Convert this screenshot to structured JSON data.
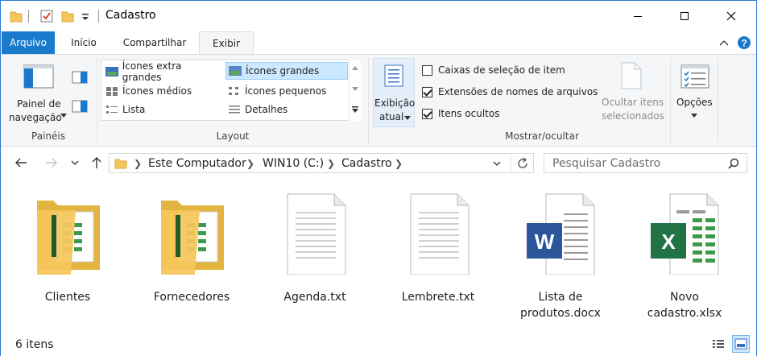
{
  "window": {
    "title": "Cadastro"
  },
  "ribbon_tabs": [
    {
      "label": "Arquivo"
    },
    {
      "label": "Início"
    },
    {
      "label": "Compartilhar"
    },
    {
      "label": "Exibir"
    }
  ],
  "ribbon": {
    "paineis": {
      "nav_pane_line1": "Painel de",
      "nav_pane_line2": "navegação",
      "group_label": "Painéis"
    },
    "layout": {
      "items": [
        {
          "label": "Ícones extra grandes"
        },
        {
          "label": "Ícones grandes"
        },
        {
          "label": "Ícones médios"
        },
        {
          "label": "Ícones pequenos"
        },
        {
          "label": "Lista"
        },
        {
          "label": "Detalhes"
        }
      ],
      "selected": "Ícones grandes",
      "current_view_line1": "Exibição",
      "current_view_line2": "atual",
      "group_label": "Layout"
    },
    "mostrar_ocultar": {
      "checkboxes": [
        {
          "label": "Caixas de seleção de item",
          "checked": false
        },
        {
          "label": "Extensões de nomes de arquivos",
          "checked": true
        },
        {
          "label": "Itens ocultos",
          "checked": true
        }
      ],
      "hide_items_line1": "Ocultar itens",
      "hide_items_line2": "selecionados",
      "options_label": "Opções",
      "group_label": "Mostrar/ocultar"
    }
  },
  "address_bar": {
    "crumbs": [
      {
        "label": "Este Computador"
      },
      {
        "label": "WIN10 (C:)"
      },
      {
        "label": "Cadastro"
      }
    ]
  },
  "search": {
    "placeholder": "Pesquisar Cadastro"
  },
  "files": [
    {
      "name": "Clientes",
      "type": "folder"
    },
    {
      "name": "Fornecedores",
      "type": "folder"
    },
    {
      "name": "Agenda.txt",
      "type": "txt"
    },
    {
      "name": "Lembrete.txt",
      "type": "txt"
    },
    {
      "name_line1": "Lista de",
      "name_line2": "produtos.docx",
      "type": "docx"
    },
    {
      "name_line1": "Novo",
      "name_line2": "cadastro.xlsx",
      "type": "xlsx"
    }
  ],
  "status": {
    "count": "6 itens"
  },
  "colors": {
    "accent": "#1979ca",
    "folder": "#f5c75a",
    "word": "#2b579a",
    "excel": "#217346"
  }
}
